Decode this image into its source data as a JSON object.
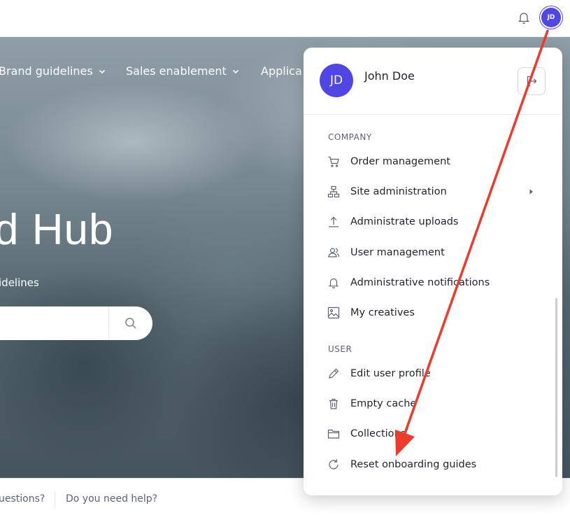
{
  "header": {
    "avatar_initials": "JD",
    "notification_icon": "bell-icon",
    "accent": "#4f46e5"
  },
  "nav": {
    "items": [
      {
        "label": "Brand guidelines"
      },
      {
        "label": "Sales enablement"
      },
      {
        "label": "Applica"
      }
    ]
  },
  "hero": {
    "title": "d Hub",
    "subtitle": "idelines",
    "search_placeholder": ""
  },
  "footer": {
    "links": [
      "uestions?",
      "Do you need help?"
    ]
  },
  "user_menu": {
    "avatar_initials": "JD",
    "name": "John Doe",
    "logout_icon": "logout-icon",
    "sections": [
      {
        "label": "COMPANY",
        "items": [
          {
            "label": "Order management",
            "icon": "cart-icon"
          },
          {
            "label": "Site administration",
            "icon": "sitemap-icon",
            "has_submenu": true
          },
          {
            "label": "Administrate uploads",
            "icon": "upload-icon"
          },
          {
            "label": "User management",
            "icon": "users-icon"
          },
          {
            "label": "Administrative notifications",
            "icon": "bell-icon"
          },
          {
            "label": "My creatives",
            "icon": "image-icon"
          }
        ]
      },
      {
        "label": "USER",
        "items": [
          {
            "label": "Edit user profile",
            "icon": "pencil-icon"
          },
          {
            "label": "Empty cache",
            "icon": "trash-icon"
          },
          {
            "label": "Collections",
            "icon": "folder-icon"
          },
          {
            "label": "Reset onboarding guides",
            "icon": "refresh-icon"
          }
        ]
      }
    ]
  },
  "annotation": {
    "color": "#ef3a2b"
  }
}
